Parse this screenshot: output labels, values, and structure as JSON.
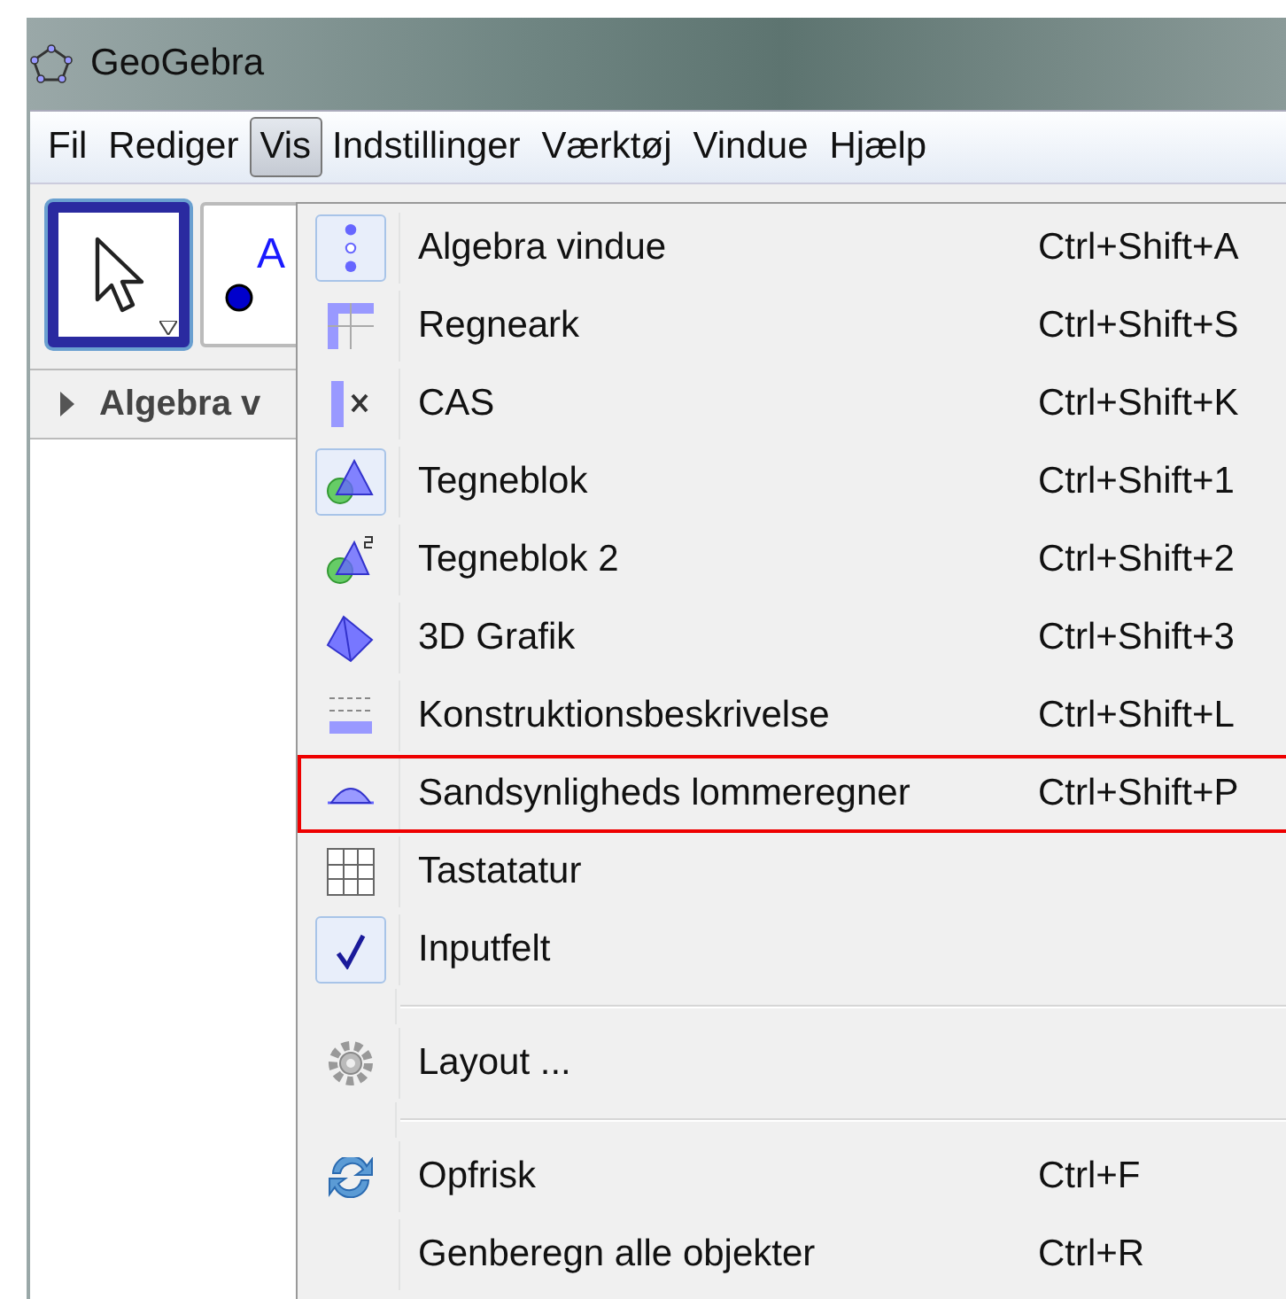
{
  "window": {
    "title": "GeoGebra"
  },
  "menubar": [
    {
      "label": "Fil",
      "selected": false
    },
    {
      "label": "Rediger",
      "selected": false
    },
    {
      "label": "Vis",
      "selected": true
    },
    {
      "label": "Indstillinger",
      "selected": false
    },
    {
      "label": "Værktøj",
      "selected": false
    },
    {
      "label": "Vindue",
      "selected": false
    },
    {
      "label": "Hjælp",
      "selected": false
    }
  ],
  "toolbar": [
    {
      "selected": true
    },
    {
      "label": "A",
      "selected": false
    }
  ],
  "algebra_panel": {
    "title": "Algebra v"
  },
  "menu": [
    {
      "kind": "item",
      "label": "Algebra vindue",
      "shortcut": "Ctrl+Shift+A",
      "checked": true,
      "highlighted": false
    },
    {
      "kind": "item",
      "label": "Regneark",
      "shortcut": "Ctrl+Shift+S",
      "checked": false,
      "highlighted": false
    },
    {
      "kind": "item",
      "label": "CAS",
      "shortcut": "Ctrl+Shift+K",
      "checked": false,
      "highlighted": false
    },
    {
      "kind": "item",
      "label": "Tegneblok",
      "shortcut": "Ctrl+Shift+1",
      "checked": true,
      "highlighted": false
    },
    {
      "kind": "item",
      "label": "Tegneblok 2",
      "shortcut": "Ctrl+Shift+2",
      "checked": false,
      "highlighted": false
    },
    {
      "kind": "item",
      "label": "3D Grafik",
      "shortcut": "Ctrl+Shift+3",
      "checked": false,
      "highlighted": false
    },
    {
      "kind": "item",
      "label": "Konstruktionsbeskrivelse",
      "shortcut": "Ctrl+Shift+L",
      "checked": false,
      "highlighted": false
    },
    {
      "kind": "item",
      "label": "Sandsynligheds lommeregner",
      "shortcut": "Ctrl+Shift+P",
      "checked": false,
      "highlighted": true
    },
    {
      "kind": "item",
      "label": "Tastatatur",
      "checked": false,
      "highlighted": false
    },
    {
      "kind": "item",
      "label": "Inputfelt",
      "checked": true,
      "highlighted": false
    },
    {
      "kind": "separator"
    },
    {
      "kind": "item",
      "label": "Layout ...",
      "checked": false,
      "highlighted": false
    },
    {
      "kind": "separator"
    },
    {
      "kind": "item",
      "label": "Opfrisk",
      "shortcut": "Ctrl+F",
      "checked": false,
      "highlighted": false
    },
    {
      "kind": "item",
      "label": "Genberegn alle objekter",
      "shortcut": "Ctrl+R",
      "checked": false,
      "highlighted": false
    }
  ]
}
